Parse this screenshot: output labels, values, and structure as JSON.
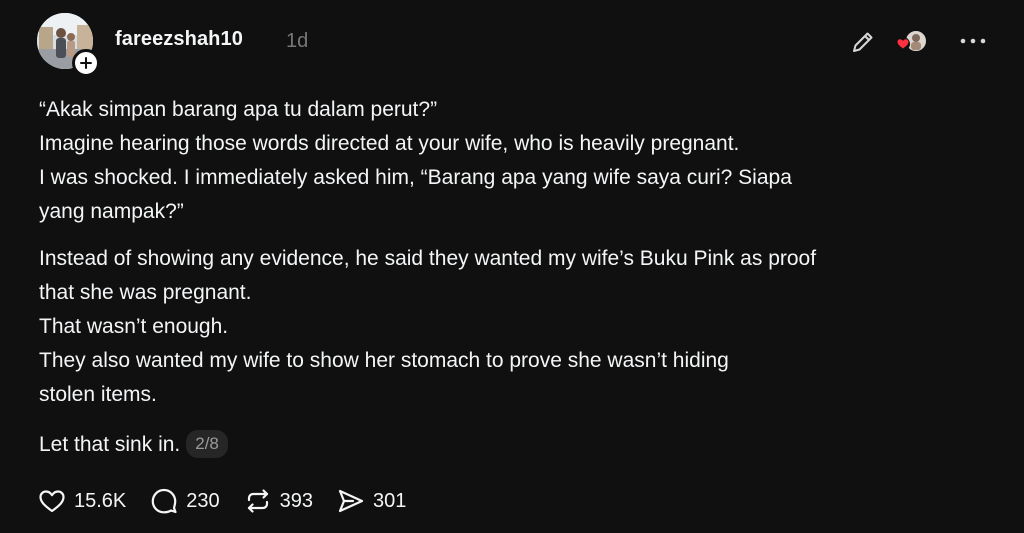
{
  "post": {
    "author": {
      "username": "fareezshah10",
      "timestamp": "1d"
    },
    "paragraphs": [
      [
        "“Akak simpan barang apa tu dalam perut?”",
        "Imagine hearing those words directed at your wife, who is heavily pregnant.",
        "I was shocked. I immediately asked him, “Barang apa yang wife saya curi? Siapa",
        "yang nampak?”"
      ],
      [
        "Instead of showing any evidence, he said they wanted my wife’s Buku Pink as proof",
        "that she was pregnant.",
        "That wasn’t enough.",
        "They also wanted my wife to show her stomach to prove she wasn’t hiding",
        "stolen items."
      ],
      [
        "Let that sink in."
      ]
    ],
    "thread_position": "2/8",
    "actions": {
      "likes": "15.6K",
      "replies": "230",
      "reposts": "393",
      "shares": "301"
    },
    "icons": {
      "follow": "plus-icon",
      "edit": "pencil-icon",
      "more": "more-horizontal-icon",
      "like": "heart-icon",
      "reply": "comment-bubble-icon",
      "repost": "repost-icon",
      "share": "send-icon"
    },
    "colors": {
      "background": "#101010",
      "text": "#f3f5f7",
      "muted": "#777777",
      "heart_badge": "#ff3040"
    }
  }
}
